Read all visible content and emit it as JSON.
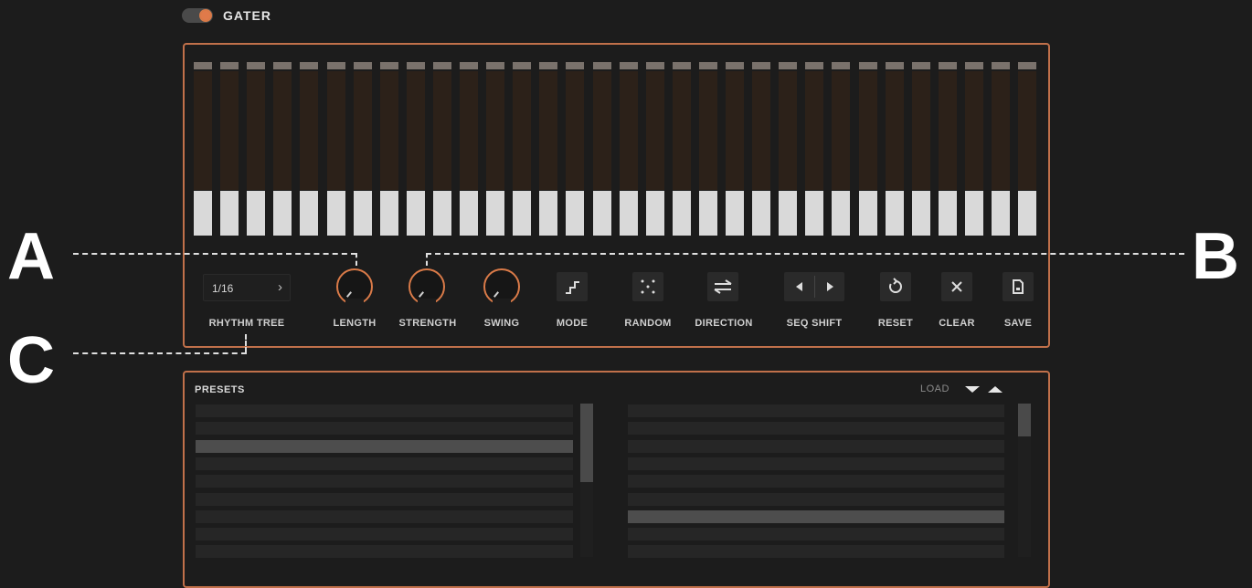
{
  "header": {
    "title": "GATER",
    "enabled": true
  },
  "steps": {
    "count": 32,
    "fill_levels": [
      0.3,
      0.3,
      0.3,
      0.3,
      0.3,
      0.3,
      0.3,
      0.3,
      0.3,
      0.3,
      0.3,
      0.3,
      0.3,
      0.3,
      0.3,
      0.3,
      0.3,
      0.3,
      0.3,
      0.3,
      0.3,
      0.3,
      0.3,
      0.3,
      0.3,
      0.3,
      0.3,
      0.3,
      0.3,
      0.3,
      0.3,
      0.3
    ]
  },
  "controls": {
    "rhythm": {
      "value": "1/16",
      "label": "RHYTHM TREE"
    },
    "length": {
      "label": "LENGTH"
    },
    "strength": {
      "label": "STRENGTH"
    },
    "swing": {
      "label": "SWING"
    },
    "mode": {
      "label": "MODE"
    },
    "random": {
      "label": "RANDOM"
    },
    "direction": {
      "label": "DIRECTION"
    },
    "seq_shift": {
      "label": "SEQ SHIFT"
    },
    "reset": {
      "label": "RESET"
    },
    "clear": {
      "label": "CLEAR"
    },
    "save": {
      "label": "SAVE"
    }
  },
  "callouts": {
    "a": "A",
    "b": "B",
    "c": "C"
  },
  "presets": {
    "title": "PRESETS",
    "load_label": "LOAD"
  },
  "colors": {
    "accent": "#d97a48",
    "step_fill": "#d9d9d9",
    "step_bg": "#2c2119",
    "panel_border": "#c0704a"
  }
}
